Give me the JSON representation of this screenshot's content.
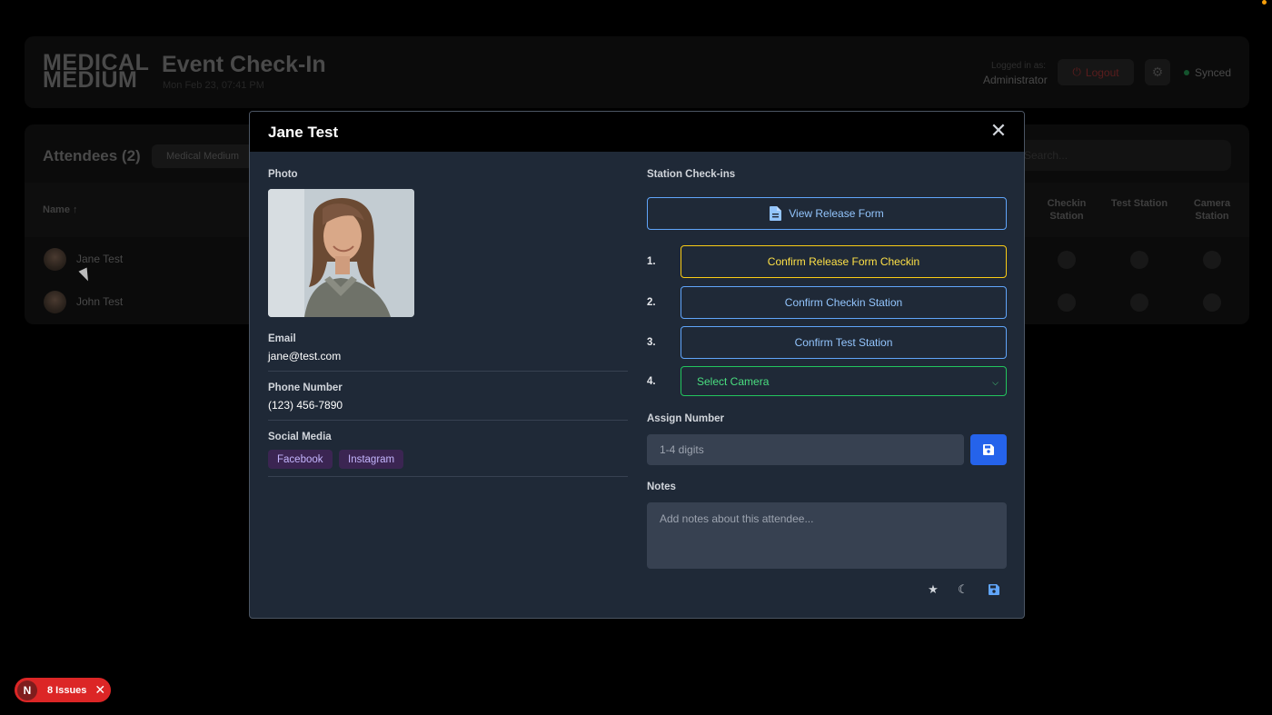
{
  "header": {
    "logo_line1": "MEDICAL",
    "logo_line2": "MEDIUM",
    "title": "Event Check-In",
    "subtitle": "Mon Feb 23, 07:41 PM",
    "logged_in_label": "Logged in as:",
    "logged_in_user": "Administrator",
    "logout_label": "Logout",
    "sync_status": "Synced"
  },
  "attendees": {
    "title": "Attendees (2)",
    "filter_chip": "Medical Medium",
    "search_placeholder": "Search...",
    "columns": {
      "name": "Name ↑",
      "checkin": "Checkin Station",
      "test": "Test Station",
      "camera": "Camera Station"
    },
    "rows": [
      {
        "name": "Jane Test"
      },
      {
        "name": "John Test"
      }
    ]
  },
  "modal": {
    "title": "Jane Test",
    "photo_label": "Photo",
    "email_label": "Email",
    "email_value": "jane@test.com",
    "phone_label": "Phone Number",
    "phone_value": "(123) 456-7890",
    "social_label": "Social Media",
    "social_tags": [
      "Facebook",
      "Instagram"
    ],
    "station_label": "Station Check-ins",
    "view_release_label": "View Release Form",
    "steps": [
      {
        "num": "1.",
        "label": "Confirm Release Form Checkin"
      },
      {
        "num": "2.",
        "label": "Confirm Checkin Station"
      },
      {
        "num": "3.",
        "label": "Confirm Test Station"
      },
      {
        "num": "4.",
        "label": "Select Camera"
      }
    ],
    "assign_label": "Assign Number",
    "assign_placeholder": "1-4 digits",
    "notes_label": "Notes",
    "notes_placeholder": "Add notes about this attendee..."
  },
  "issues_badge": {
    "letter": "N",
    "label": "8 Issues"
  },
  "colors": {
    "accent_blue": "#60a5fa",
    "accent_yellow": "#facc15",
    "accent_green": "#22c55e",
    "issues_red": "#dc2626"
  }
}
